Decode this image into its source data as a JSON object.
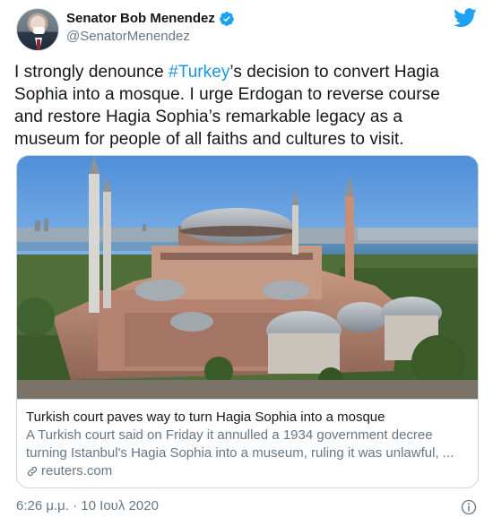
{
  "author": {
    "display_name": "Senator Bob Menendez",
    "handle": "@SenatorMenendez",
    "verified": true
  },
  "tweet": {
    "text_before": "I strongly denounce ",
    "hashtag": "#Turkey",
    "text_after": "’s decision to convert Hagia Sophia into a mosque. I urge Erdogan to reverse course and restore Hagia Sophia’s remarkable legacy as a museum for people of all faiths and cultures to visit."
  },
  "card": {
    "title": "Turkish court paves way to turn Hagia Sophia into a mosque",
    "description": "A Turkish court said on Friday it annulled a 1934 government decree turning Istanbul's Hagia Sophia into a museum, ruling it was unlawful, ...",
    "domain": "reuters.com",
    "image": "hagia-sophia-aerial-photo"
  },
  "footer": {
    "timestamp": "6:26 μ.μ. · 10 Ιουλ 2020"
  },
  "icons": {
    "brand": "twitter-bird-icon",
    "verified": "verified-badge-icon",
    "link": "link-icon",
    "info": "info-icon"
  },
  "colors": {
    "twitter_blue": "#1da1f2",
    "hashtag": "#1b95e0",
    "secondary_text": "#657786",
    "border": "#ccd6dd"
  }
}
